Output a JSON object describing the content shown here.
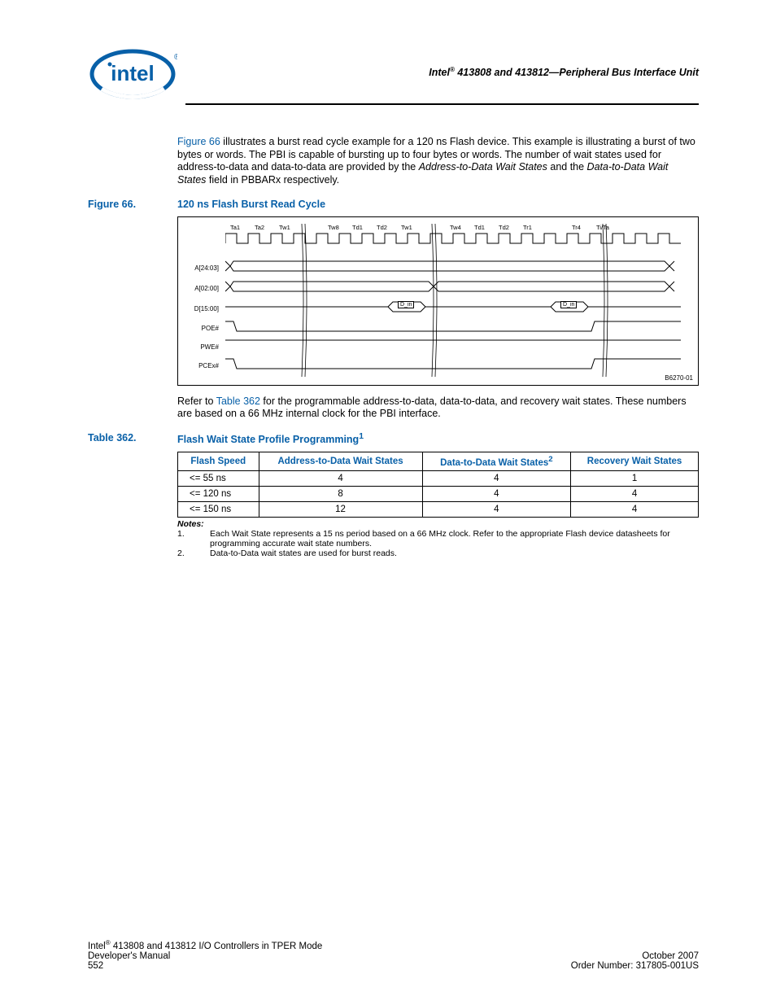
{
  "header": {
    "title_prefix": "Intel",
    "title_rest": " 413808 and 413812—Peripheral Bus Interface Unit"
  },
  "para1": {
    "link": "Figure 66",
    "rest1": " illustrates a burst read cycle example for a 120 ns Flash device. This example is illustrating a burst of two bytes or words. The PBI is capable of bursting up to four bytes or words. The number of wait states used for address-to-data and data-to-data are provided by the ",
    "it1": "Address-to-Data Wait States",
    "mid": " and the ",
    "it2": "Data-to-Data Wait States",
    "rest2": " field in PBBARx respectively."
  },
  "fig66": {
    "label": "Figure 66.",
    "title": "120 ns Flash Burst Read Cycle"
  },
  "diagram": {
    "ticks": [
      "Ta1",
      "Ta2",
      "Tw1",
      "",
      "Tw8",
      "Td1",
      "Td2",
      "Tw1",
      "",
      "Tw4",
      "Td1",
      "Td2",
      "Tr1",
      "",
      "Tr4",
      "Ti/Ta"
    ],
    "signals": [
      "A[24:03]",
      "A[02:00]",
      "D[15:00]",
      "POE#",
      "PWE#",
      "PCEx#"
    ],
    "din": "D_in",
    "id": "B6270-01"
  },
  "para2": {
    "pre": "Refer to ",
    "link": "Table 362",
    "rest": " for the programmable address-to-data, data-to-data, and recovery wait states. These numbers are based on a 66 MHz internal clock for the PBI interface."
  },
  "tab362": {
    "label": "Table 362.",
    "title": "Flash Wait State Profile Programming",
    "sup": "1"
  },
  "table": {
    "headers": {
      "c0": "Flash Speed",
      "c1": "Address-to-Data Wait States",
      "c2": "Data-to-Data Wait States",
      "c2sup": "2",
      "c3": "Recovery Wait States"
    },
    "rows": [
      {
        "speed": "<= 55 ns",
        "a": "4",
        "d": "4",
        "r": "1"
      },
      {
        "speed": "<= 120 ns",
        "a": "8",
        "d": "4",
        "r": "4"
      },
      {
        "speed": "<= 150 ns",
        "a": "12",
        "d": "4",
        "r": "4"
      }
    ]
  },
  "notes": {
    "heading": "Notes:",
    "n1num": "1.",
    "n1": "Each Wait State represents a 15 ns period based on a 66 MHz clock. Refer to the appropriate Flash device datasheets for programming accurate wait state numbers.",
    "n2num": "2.",
    "n2": "Data-to-Data wait states are used for burst reads."
  },
  "footer": {
    "l1_pre": "Intel",
    "l1_rest": " 413808 and 413812 I/O Controllers in TPER Mode",
    "l2": "Developer's Manual",
    "l3": "552",
    "r1": "October 2007",
    "r2": "Order Number: 317805-001US"
  }
}
